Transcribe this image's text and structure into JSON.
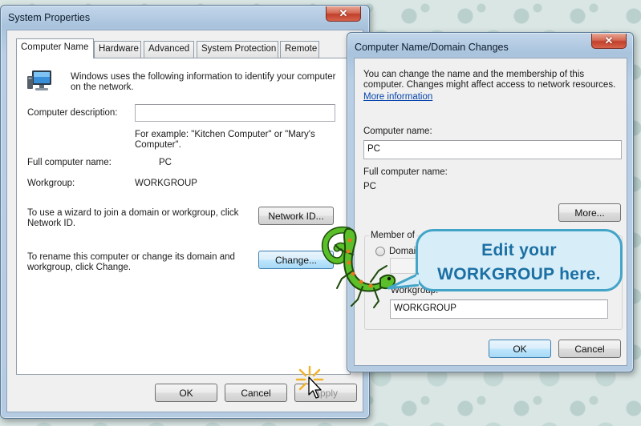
{
  "sys_props": {
    "title": "System Properties",
    "tabs": [
      {
        "label": "Computer Name"
      },
      {
        "label": "Hardware"
      },
      {
        "label": "Advanced"
      },
      {
        "label": "System Protection"
      },
      {
        "label": "Remote"
      }
    ],
    "intro_text": "Windows uses the following information to identify your computer on the network.",
    "description_label": "Computer description:",
    "description_value": "",
    "example_text": "For example: \"Kitchen Computer\" or \"Mary's Computer\".",
    "full_name_label": "Full computer name:",
    "full_name_value": "PC",
    "workgroup_label": "Workgroup:",
    "workgroup_value": "WORKGROUP",
    "network_id_text": "To use a wizard to join a domain or workgroup, click Network ID.",
    "network_id_button": "Network ID...",
    "rename_text": "To rename this computer or change its domain and workgroup, click Change.",
    "change_button": "Change...",
    "ok_button": "OK",
    "cancel_button": "Cancel",
    "apply_button": "Apply"
  },
  "domain_changes": {
    "title": "Computer Name/Domain Changes",
    "intro_text": "You can change the name and the membership of this computer. Changes might affect access to network resources.",
    "more_info_link": "More information",
    "computer_name_label": "Computer name:",
    "computer_name_value": "PC",
    "full_name_label": "Full computer name:",
    "full_name_value": "PC",
    "more_button": "More...",
    "member_of_label": "Member of",
    "domain_option": "Domain",
    "workgroup_label": "Workgroup:",
    "workgroup_value": "WORKGROUP",
    "ok_button": "OK",
    "cancel_button": "Cancel"
  },
  "callout": {
    "line1": "Edit your",
    "line2": "WORKGROUP  here."
  },
  "icons": {
    "close": "close-icon",
    "computer": "computer-icon",
    "gecko": "gecko-mascot",
    "cursor": "mouse-pointer-icon",
    "sparkle": "click-sparkle-icon"
  },
  "colors": {
    "callout_fill": "#d7eef9",
    "callout_border": "#43a4c8",
    "callout_text": "#1b6fa3",
    "gecko_green": "#5bbf2a",
    "gecko_spots": "#e8781c",
    "close_red": "#c0402b"
  }
}
